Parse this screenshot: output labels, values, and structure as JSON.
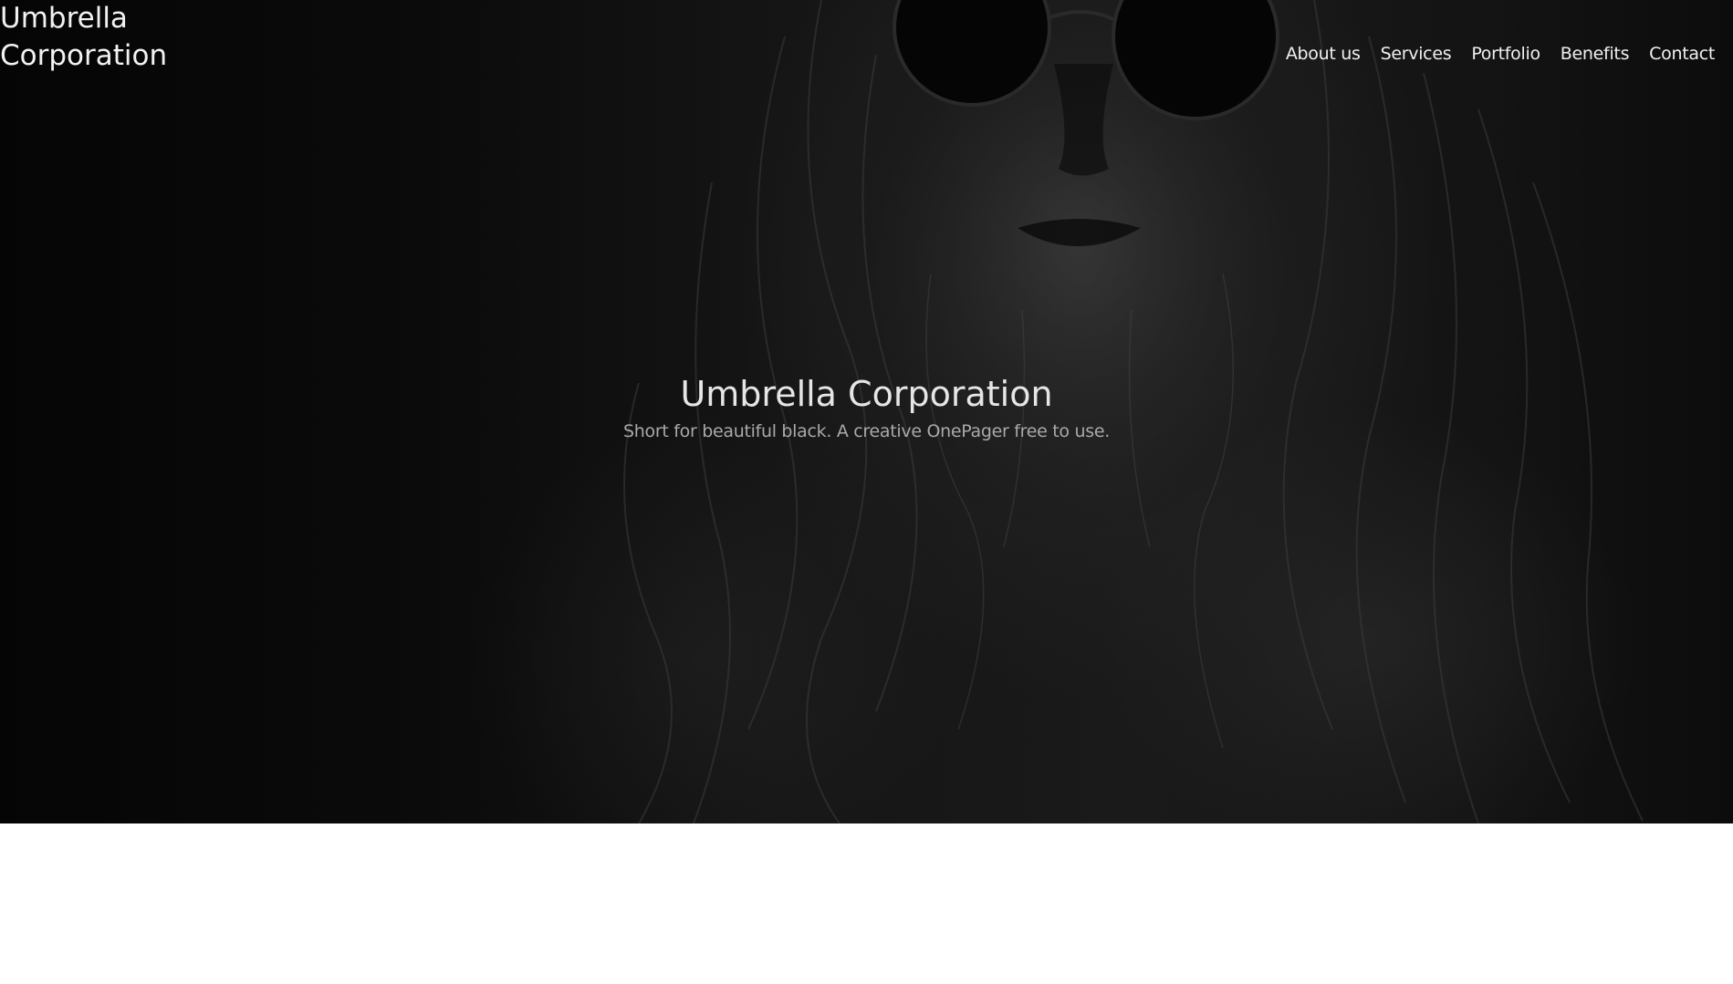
{
  "header": {
    "brand": "Umbrella Corporation",
    "nav": [
      {
        "label": "About us"
      },
      {
        "label": "Services"
      },
      {
        "label": "Portfolio"
      },
      {
        "label": "Benefits"
      },
      {
        "label": "Contact"
      }
    ]
  },
  "hero": {
    "title": "Umbrella Corporation",
    "subtitle": "Short for beautiful black. A creative OnePager free to use."
  },
  "colors": {
    "hero_background": "#111111",
    "text_primary": "#f2f2f2",
    "text_secondary": "#a9a9a9",
    "page_background": "#ffffff"
  }
}
